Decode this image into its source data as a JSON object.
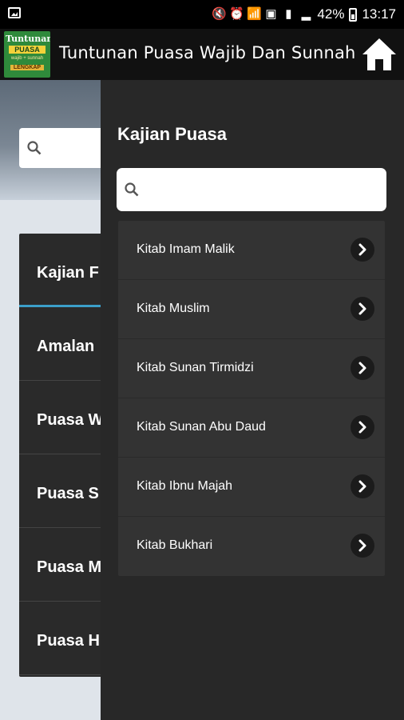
{
  "status_bar": {
    "battery_text": "42%",
    "time": "13:17"
  },
  "app_bar": {
    "title": "Tuntunan Puasa Wajib Dan Sunnah",
    "logo": {
      "line1": "Tuntunan",
      "line2": "PUASA",
      "line3": "wajib + sunnah",
      "line4": "LENGKAP"
    },
    "home_icon": "home-icon"
  },
  "background_list": {
    "search_placeholder": "",
    "items": [
      "Kajian F",
      "Amalan",
      "Puasa W",
      "Puasa S",
      "Puasa M",
      "Puasa H"
    ]
  },
  "drawer": {
    "title": "Kajian Puasa",
    "search": {
      "value": "",
      "placeholder": ""
    },
    "items": [
      {
        "label": "Kitab Imam Malik"
      },
      {
        "label": "Kitab Muslim"
      },
      {
        "label": "Kitab Sunan Tirmidzi"
      },
      {
        "label": "Kitab Sunan Abu Daud"
      },
      {
        "label": "Kitab Ibnu Majah"
      },
      {
        "label": "Kitab Bukhari"
      }
    ]
  },
  "colors": {
    "drawer_bg": "#282828",
    "list_bg": "#333333",
    "accent": "#3b9fc9"
  }
}
